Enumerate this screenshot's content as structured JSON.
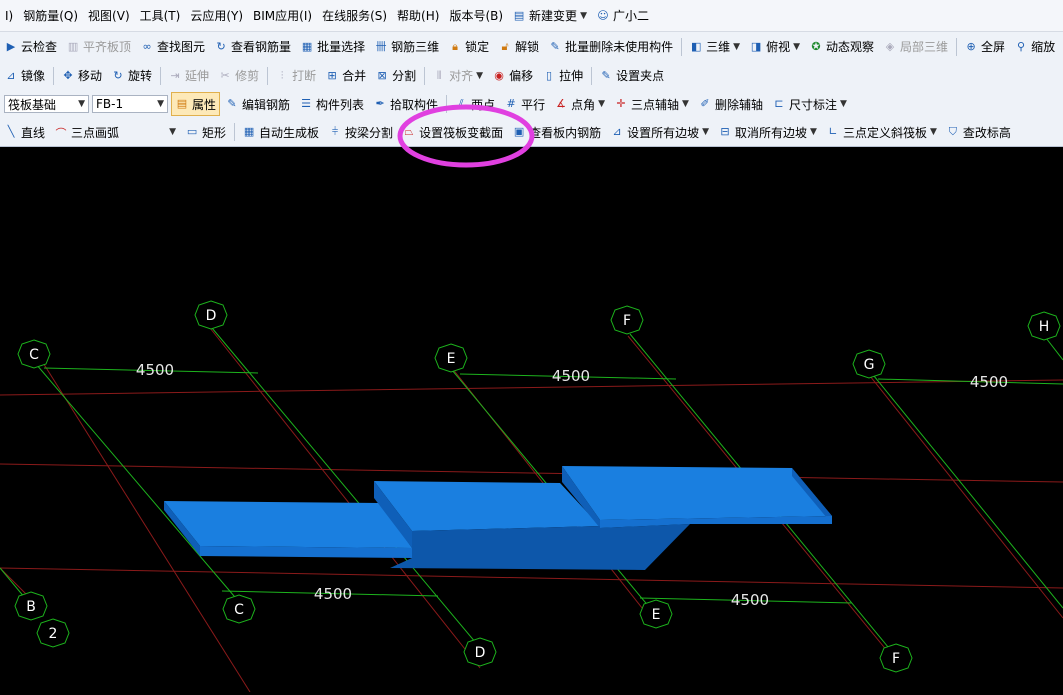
{
  "menubar": {
    "items": [
      "I)",
      "钢筋量(Q)",
      "视图(V)",
      "工具(T)",
      "云应用(Y)",
      "BIM应用(I)",
      "在线服务(S)",
      "帮助(H)",
      "版本号(B)",
      "新建变更",
      "广小二"
    ]
  },
  "toolbar1": {
    "cloud_check": "云检查",
    "flush_top": "平齐板顶",
    "find_element": "查找图元",
    "view_rebar_qty": "查看钢筋量",
    "batch_select": "批量选择",
    "rebar_3d": "钢筋三维",
    "lock": "锁定",
    "unlock": "解锁",
    "batch_delete_unused": "批量删除未使用构件",
    "view_3d": "三维",
    "top_view": "俯视",
    "dynamic_view": "动态观察",
    "local_3d": "局部三维",
    "full_screen": "全屏",
    "zoom": "缩放"
  },
  "toolbar2": {
    "mirror": "镜像",
    "move": "移动",
    "rotate": "旋转",
    "extend": "延伸",
    "trim": "修剪",
    "break": "打断",
    "merge": "合并",
    "split": "分割",
    "align": "对齐",
    "offset": "偏移",
    "stretch": "拉伸",
    "set_grip": "设置夹点"
  },
  "toolbar3": {
    "component_type": "筏板基础",
    "component_name": "FB-1",
    "properties": "属性",
    "edit_rebar": "编辑钢筋",
    "component_list": "构件列表",
    "pick_component": "拾取构件",
    "two_points": "两点",
    "parallel": "平行",
    "point_angle": "点角",
    "three_point_axis": "三点辅轴",
    "delete_axis": "删除辅轴",
    "dimension": "尺寸标注"
  },
  "toolbar4": {
    "line": "直线",
    "arc_mode": "三点画弧",
    "rectangle": "矩形",
    "auto_generate": "自动生成板",
    "split_by_beam": "按梁分割",
    "set_raft_section": "设置筏板变截面",
    "view_slab_rebar": "查看板内钢筋",
    "set_all_slopes": "设置所有边坡",
    "cancel_all_slopes": "取消所有边坡",
    "three_point_slope": "三点定义斜筏板",
    "check_elevation": "查改标高"
  },
  "viewport": {
    "grid_labels": [
      "C",
      "D",
      "E",
      "F",
      "G",
      "H",
      "C",
      "D",
      "E",
      "F",
      "B",
      "2"
    ],
    "dimensions": [
      "4500",
      "4500",
      "4500",
      "4500",
      "4500"
    ]
  },
  "colors": {
    "slab_top": "#1a7fe0",
    "slab_side": "#0f5fb8",
    "axis_green": "#1db31d",
    "axis_red": "#8a1a1a",
    "highlight": "#e040e0"
  }
}
